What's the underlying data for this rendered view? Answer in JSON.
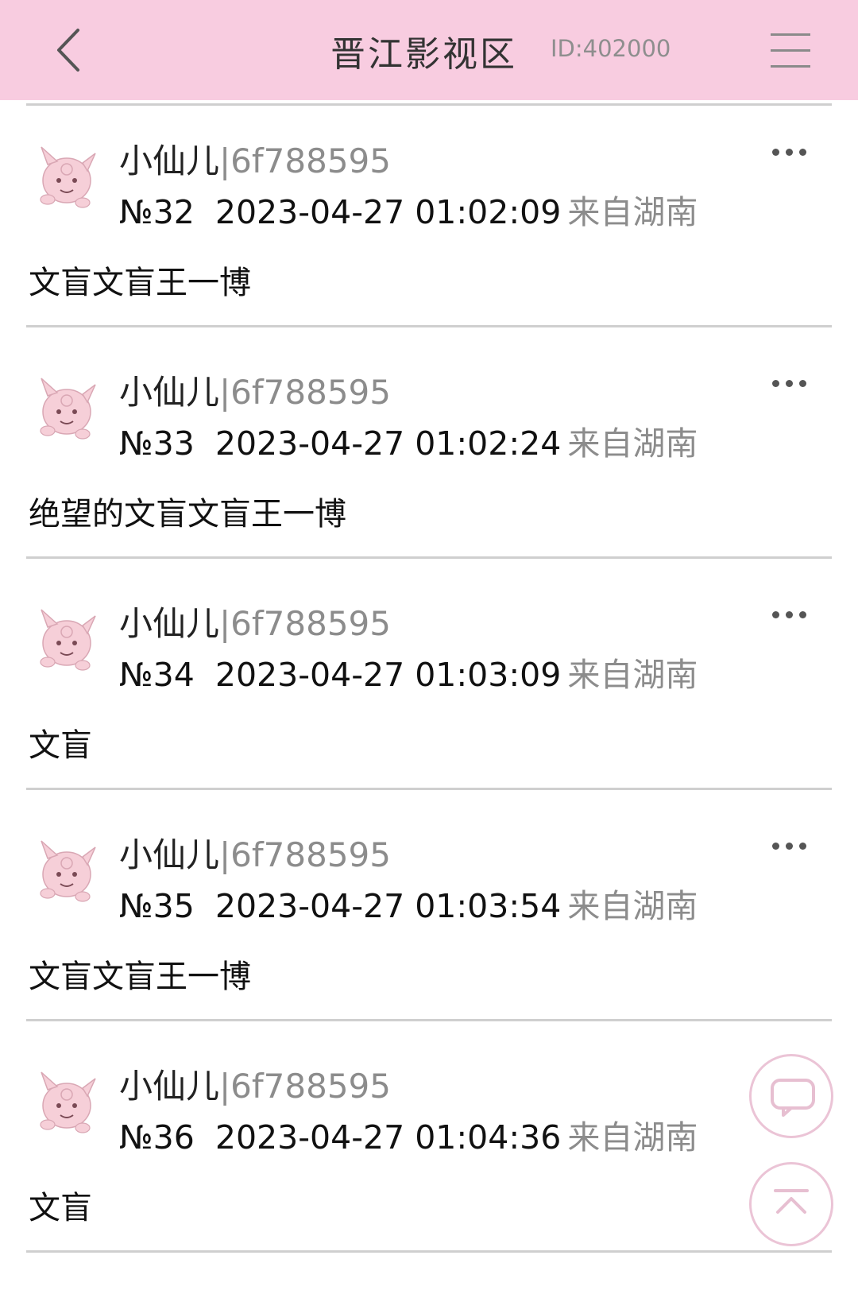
{
  "header": {
    "title": "晋江影视区",
    "board_id": "ID:402000",
    "bg_color": "#f8cce0"
  },
  "posts": [
    {
      "author": "小仙儿",
      "uid": "|6f788595",
      "number": "№32",
      "time": "2023-04-27 01:02:09",
      "location": "来自湖南",
      "content": "文盲文盲王一博"
    },
    {
      "author": "小仙儿",
      "uid": "|6f788595",
      "number": "№33",
      "time": "2023-04-27 01:02:24",
      "location": "来自湖南",
      "content": "绝望的文盲文盲王一博"
    },
    {
      "author": "小仙儿",
      "uid": "|6f788595",
      "number": "№34",
      "time": "2023-04-27 01:03:09",
      "location": "来自湖南",
      "content": "文盲"
    },
    {
      "author": "小仙儿",
      "uid": "|6f788595",
      "number": "№35",
      "time": "2023-04-27 01:03:54",
      "location": "来自湖南",
      "content": "文盲文盲王一博"
    },
    {
      "author": "小仙儿",
      "uid": "|6f788595",
      "number": "№36",
      "time": "2023-04-27 01:04:36",
      "location": "来自湖南",
      "content": "文盲"
    }
  ],
  "floating": {
    "comment_icon": "chat-bubble-icon",
    "top_icon": "scroll-to-top-icon"
  }
}
